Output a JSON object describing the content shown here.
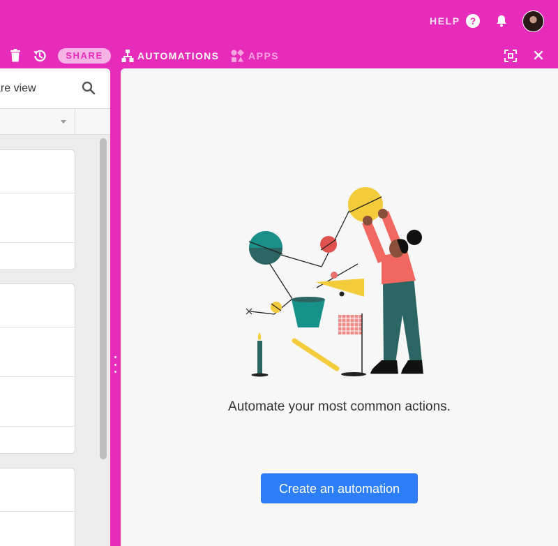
{
  "header": {
    "help_label": "HELP",
    "help_icon": "question-circle-icon",
    "notifications_icon": "bell-icon",
    "avatar_icon": "user-avatar"
  },
  "toolbar": {
    "trash_icon": "trash-icon",
    "history_icon": "history-icon",
    "share_label": "SHARE",
    "automations_label": "AUTOMATIONS",
    "automations_icon": "automations-icon",
    "apps_label": "APPS",
    "apps_icon": "apps-icon",
    "expand_icon": "expand-icon",
    "close_icon": "close-icon"
  },
  "left_panel": {
    "view_name": "are view",
    "search_icon": "search-icon"
  },
  "automations_panel": {
    "empty_message": "Automate your most common actions.",
    "create_button_label": "Create an automation"
  },
  "colors": {
    "brand_pink": "#e72bbb",
    "button_blue": "#2d7ff9",
    "panel_background": "#f7f7f7"
  }
}
